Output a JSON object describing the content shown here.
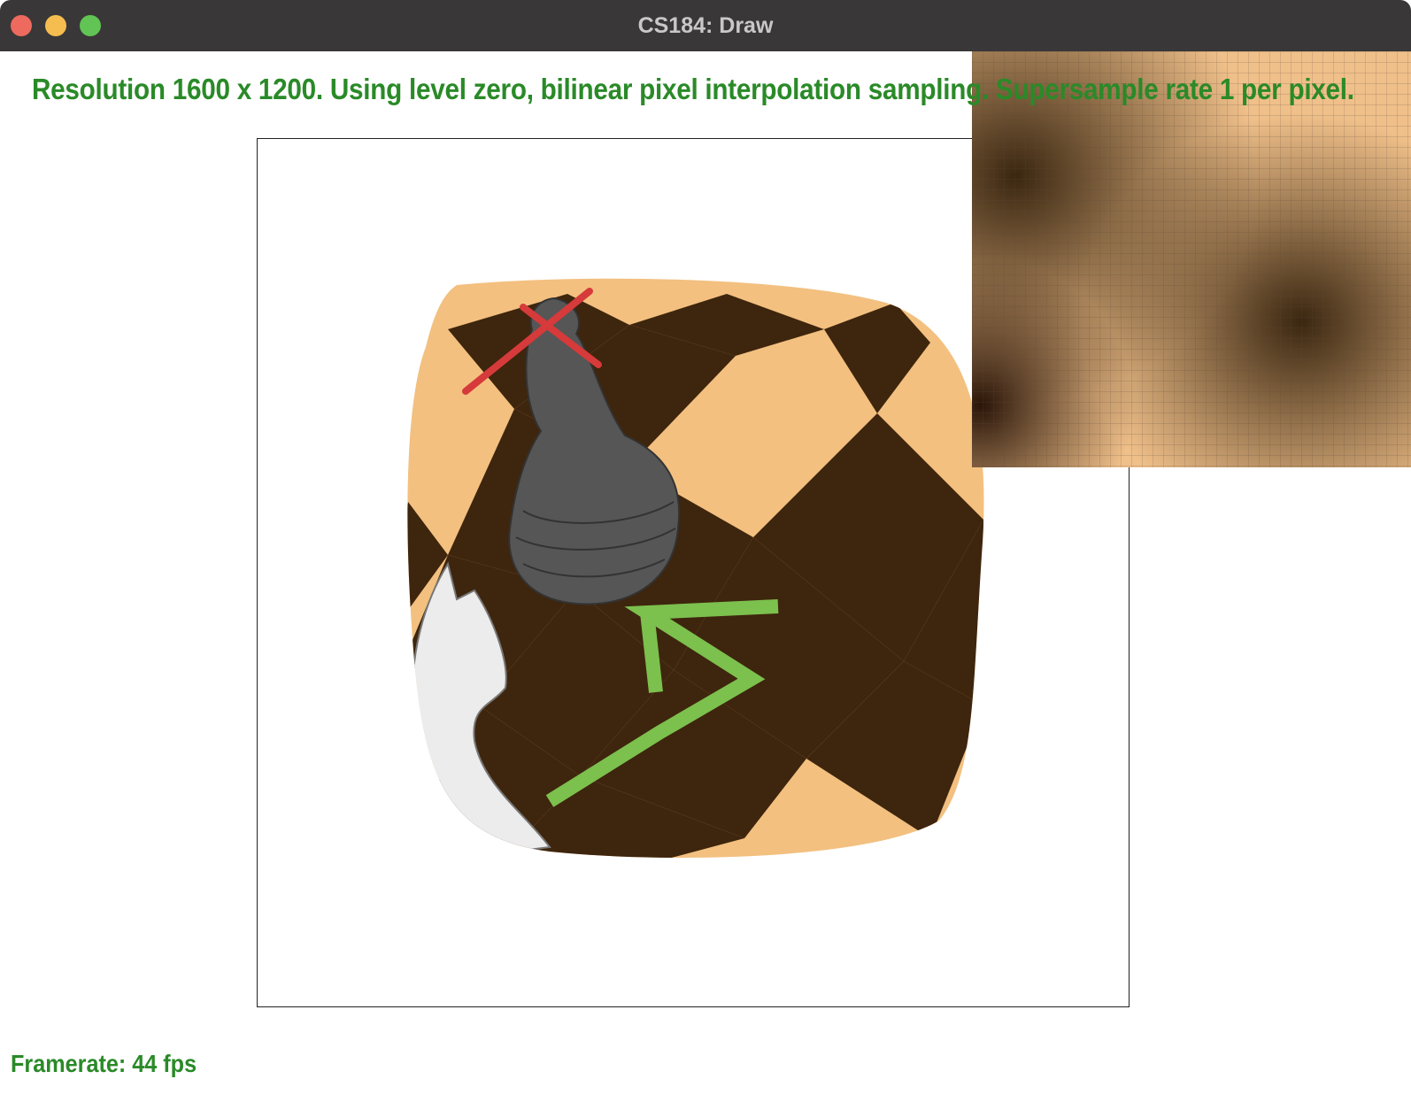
{
  "window": {
    "title": "CS184: Draw"
  },
  "status": {
    "text": "Resolution 1600 x 1200. Using level zero, bilinear pixel interpolation sampling. Supersample rate 1 per pixel."
  },
  "footer": {
    "framerate": "Framerate: 44 fps"
  },
  "colors": {
    "text_green": "#2a8a28",
    "board_light": "#f3c080",
    "board_dark": "#3e250d",
    "arrow": "#7cc04e",
    "x_mark": "#d63a3a"
  },
  "icons": [
    "close-window-icon",
    "minimize-window-icon",
    "zoom-window-icon",
    "black-pawn-icon",
    "white-knight-icon",
    "red-x-icon",
    "green-arrow-icon"
  ]
}
